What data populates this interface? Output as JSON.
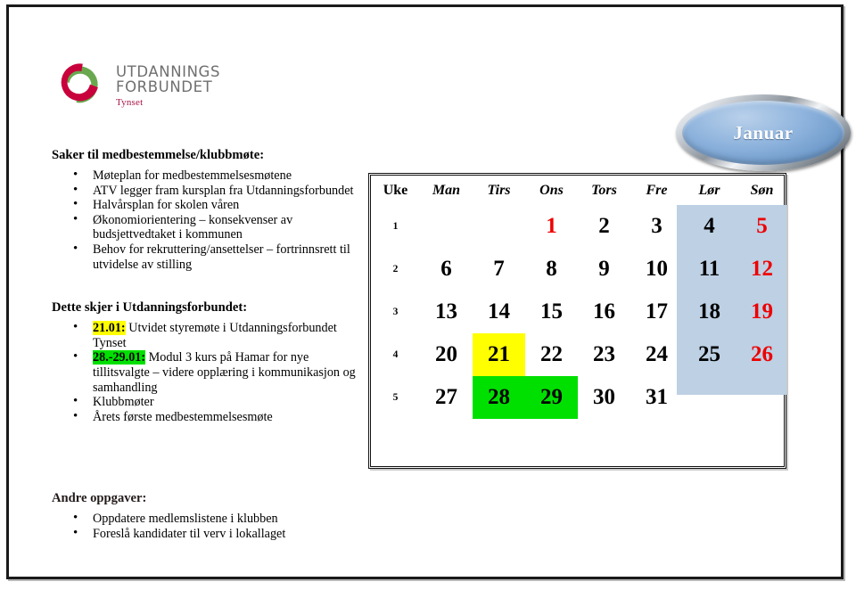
{
  "logo": {
    "line1": "UTDANNINGS",
    "line2": "FORBUNDET",
    "sub": "Tynset",
    "colors": {
      "red": "#c8003c",
      "green": "#6aa84f",
      "text": "#6f6f6f",
      "sub": "#a8184a"
    }
  },
  "month_badge": {
    "label": "Januar",
    "fill": "#8cb2dc",
    "text_color": "#ffffff"
  },
  "sections": [
    {
      "id": "saker",
      "heading": "Saker til medbestemmelse/klubbmøte:",
      "items": [
        {
          "text": "Møteplan for medbestemmelsesmøtene"
        },
        {
          "text": "ATV legger fram kursplan fra Utdanningsforbundet"
        },
        {
          "text": "Halvårsplan for skolen våren"
        },
        {
          "text": "Økonomiorientering – konsekvenser av budsjettvedtaket i kommunen"
        },
        {
          "text": "Behov for rekruttering/ansettelser – fortrinnsrett til utvidelse av stilling"
        }
      ]
    },
    {
      "id": "dette",
      "heading": "Dette skjer i Utdanningsforbundet:",
      "items": [
        {
          "label": "21.01:",
          "label_highlight": "#ffff00",
          "text": "Utvidet styremøte i Utdanningsforbundet Tynset"
        },
        {
          "label": "28.-29.01:",
          "label_highlight": "#00e000",
          "text": "Modul 3 kurs på Hamar for nye tillitsvalgte – videre opplæring i kommunikasjon og samhandling"
        },
        {
          "text": "Klubbmøter"
        },
        {
          "text": "Årets første medbestemmelsesmøte"
        }
      ]
    },
    {
      "id": "andre",
      "heading": "Andre oppgaver:",
      "items": [
        {
          "text": "Oppdatere medlemslistene i klubben"
        },
        {
          "text": "Foreslå kandidater til verv i lokallaget"
        }
      ]
    }
  ],
  "calendar": {
    "headers": [
      "Uke",
      "Man",
      "Tirs",
      "Ons",
      "Tors",
      "Fre",
      "Lør",
      "Søn"
    ],
    "weekend_shade_color": "#bdd0e4",
    "sunday_text_color": "#ee0000",
    "rows": [
      {
        "week": "1",
        "days": [
          {
            "n": ""
          },
          {
            "n": ""
          },
          {
            "n": "1",
            "red": true
          },
          {
            "n": "2"
          },
          {
            "n": "3"
          },
          {
            "n": "4"
          },
          {
            "n": "5",
            "red": true
          }
        ]
      },
      {
        "week": "2",
        "days": [
          {
            "n": "6"
          },
          {
            "n": "7"
          },
          {
            "n": "8"
          },
          {
            "n": "9"
          },
          {
            "n": "10"
          },
          {
            "n": "11"
          },
          {
            "n": "12",
            "red": true
          }
        ]
      },
      {
        "week": "3",
        "days": [
          {
            "n": "13"
          },
          {
            "n": "14"
          },
          {
            "n": "15"
          },
          {
            "n": "16"
          },
          {
            "n": "17"
          },
          {
            "n": "18"
          },
          {
            "n": "19",
            "red": true
          }
        ]
      },
      {
        "week": "4",
        "days": [
          {
            "n": "20"
          },
          {
            "n": "21",
            "highlight": "#ffff00"
          },
          {
            "n": "22"
          },
          {
            "n": "23"
          },
          {
            "n": "24"
          },
          {
            "n": "25"
          },
          {
            "n": "26",
            "red": true
          }
        ]
      },
      {
        "week": "5",
        "days": [
          {
            "n": "27"
          },
          {
            "n": "28",
            "highlight": "#00e000"
          },
          {
            "n": "29",
            "highlight": "#00e000"
          },
          {
            "n": "30"
          },
          {
            "n": "31"
          },
          {
            "n": ""
          },
          {
            "n": ""
          }
        ]
      }
    ]
  }
}
